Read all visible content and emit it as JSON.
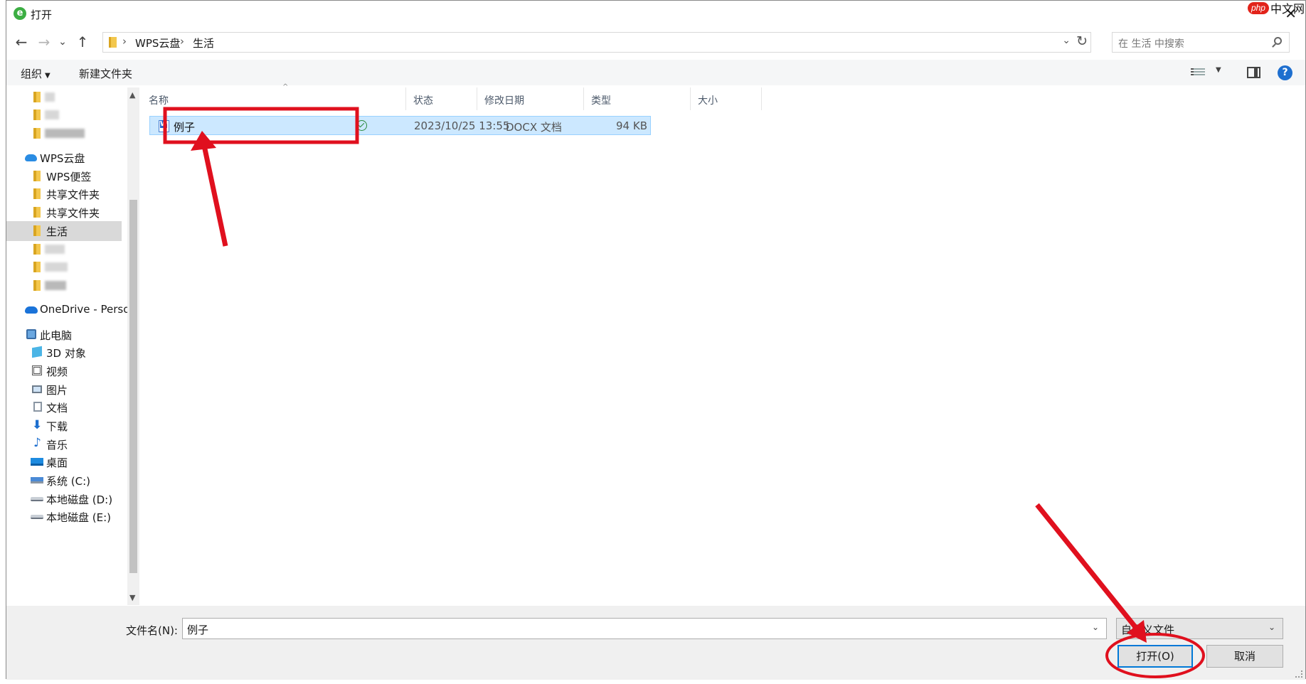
{
  "window": {
    "title": "打开",
    "close_glyph": "✕"
  },
  "watermark": {
    "brand": "php",
    "text": "中文网"
  },
  "nav_buttons": {
    "back": "←",
    "forward": "→",
    "recent": "⌄",
    "up": "↑"
  },
  "address": {
    "crumbs": [
      "WPS云盘",
      "生活"
    ],
    "separator": "›"
  },
  "search": {
    "placeholder": "在 生活 中搜索"
  },
  "toolbar": {
    "organize_label": "组织",
    "new_folder_label": "新建文件夹"
  },
  "sidebar": {
    "items": [
      {
        "label": "",
        "icon": "folder-icon",
        "blurred": true
      },
      {
        "label": "",
        "icon": "folder-icon",
        "blurred": true
      },
      {
        "label": "",
        "icon": "folder-icon",
        "blurred": true
      },
      {
        "label": "WPS云盘",
        "icon": "cloud-icon"
      },
      {
        "label": "WPS便签",
        "icon": "folder-icon"
      },
      {
        "label": "共享文件夹",
        "icon": "shared-folder-icon"
      },
      {
        "label": "共享文件夹",
        "icon": "shared-folder-icon"
      },
      {
        "label": "生活",
        "icon": "folder-icon",
        "selected": true
      },
      {
        "label": "",
        "icon": "folder-icon",
        "blurred": true
      },
      {
        "label": "",
        "icon": "folder-icon",
        "blurred": true
      },
      {
        "label": "",
        "icon": "folder-icon",
        "blurred": true
      },
      {
        "label": "OneDrive - Personal",
        "icon": "onedrive-icon"
      },
      {
        "label": "此电脑",
        "icon": "computer-icon"
      },
      {
        "label": "3D 对象",
        "icon": "3d-objects-icon"
      },
      {
        "label": "视频",
        "icon": "video-icon"
      },
      {
        "label": "图片",
        "icon": "pictures-icon"
      },
      {
        "label": "文档",
        "icon": "documents-icon"
      },
      {
        "label": "下载",
        "icon": "download-icon"
      },
      {
        "label": "音乐",
        "icon": "music-icon"
      },
      {
        "label": "桌面",
        "icon": "desktop-icon"
      },
      {
        "label": "系统 (C:)",
        "icon": "system-drive-icon"
      },
      {
        "label": "本地磁盘 (D:)",
        "icon": "drive-icon"
      },
      {
        "label": "本地磁盘 (E:)",
        "icon": "drive-icon"
      }
    ]
  },
  "file_list": {
    "columns": [
      "名称",
      "状态",
      "修改日期",
      "类型",
      "大小"
    ],
    "rows": [
      {
        "name": "例子",
        "status_icon": "synced-check-icon",
        "modified": "2023/10/25 13:55",
        "type": "DOCX 文档",
        "size": "94 KB"
      }
    ]
  },
  "bottom": {
    "filename_label": "文件名(N):",
    "filename_value": "例子",
    "filetype_value": "自定义文件",
    "open_label": "打开(O)",
    "cancel_label": "取消"
  },
  "colors": {
    "selection_bg": "#cce8ff",
    "annotation_red": "#e0101e",
    "accent_blue": "#0078d7"
  }
}
